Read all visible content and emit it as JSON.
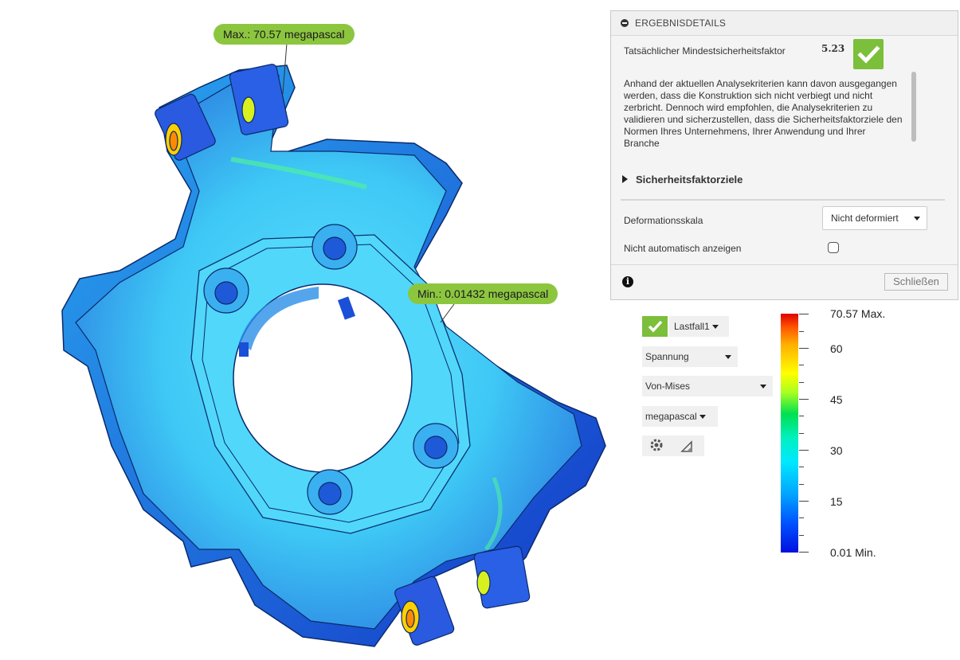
{
  "viewport": {
    "callout_max": "Max.: 70.57 megapascal",
    "callout_min": "Min.: 0.01432 megapascal"
  },
  "results_panel": {
    "header": "ERGEBNISDETAILS",
    "safety_factor_label": "Tatsächlicher Mindestsicherheitsfaktor",
    "safety_factor_value": "5.23",
    "description": "Anhand der aktuellen Analysekriterien kann davon ausgegangen werden, dass die Konstruktion sich nicht verbiegt und nicht zerbricht. Dennoch wird empfohlen, die Analysekriterien zu validieren und sicherzustellen, dass die Sicherheitsfaktorziele den Normen Ihres Unternehmens, Ihrer Anwendung und Ihrer Branche",
    "safety_targets": "Sicherheitsfaktorziele",
    "deformation_scale_label": "Deformationsskala",
    "deformation_scale_value": "Nicht deformiert",
    "no_auto_show_label": "Nicht automatisch anzeigen",
    "no_auto_show_checked": false,
    "close_label": "Schließen"
  },
  "legend": {
    "load_case": "Lastfall1",
    "result_type": "Spannung",
    "component": "Von-Mises",
    "unit": "megapascal",
    "scale": {
      "max_label": "70.57 Max.",
      "t60": "60",
      "t45": "45",
      "t30": "30",
      "t15": "15",
      "min_label": "0.01 Min."
    }
  },
  "colors": {
    "accent_green": "#8cc63f",
    "check_green": "#7bbf3a"
  }
}
